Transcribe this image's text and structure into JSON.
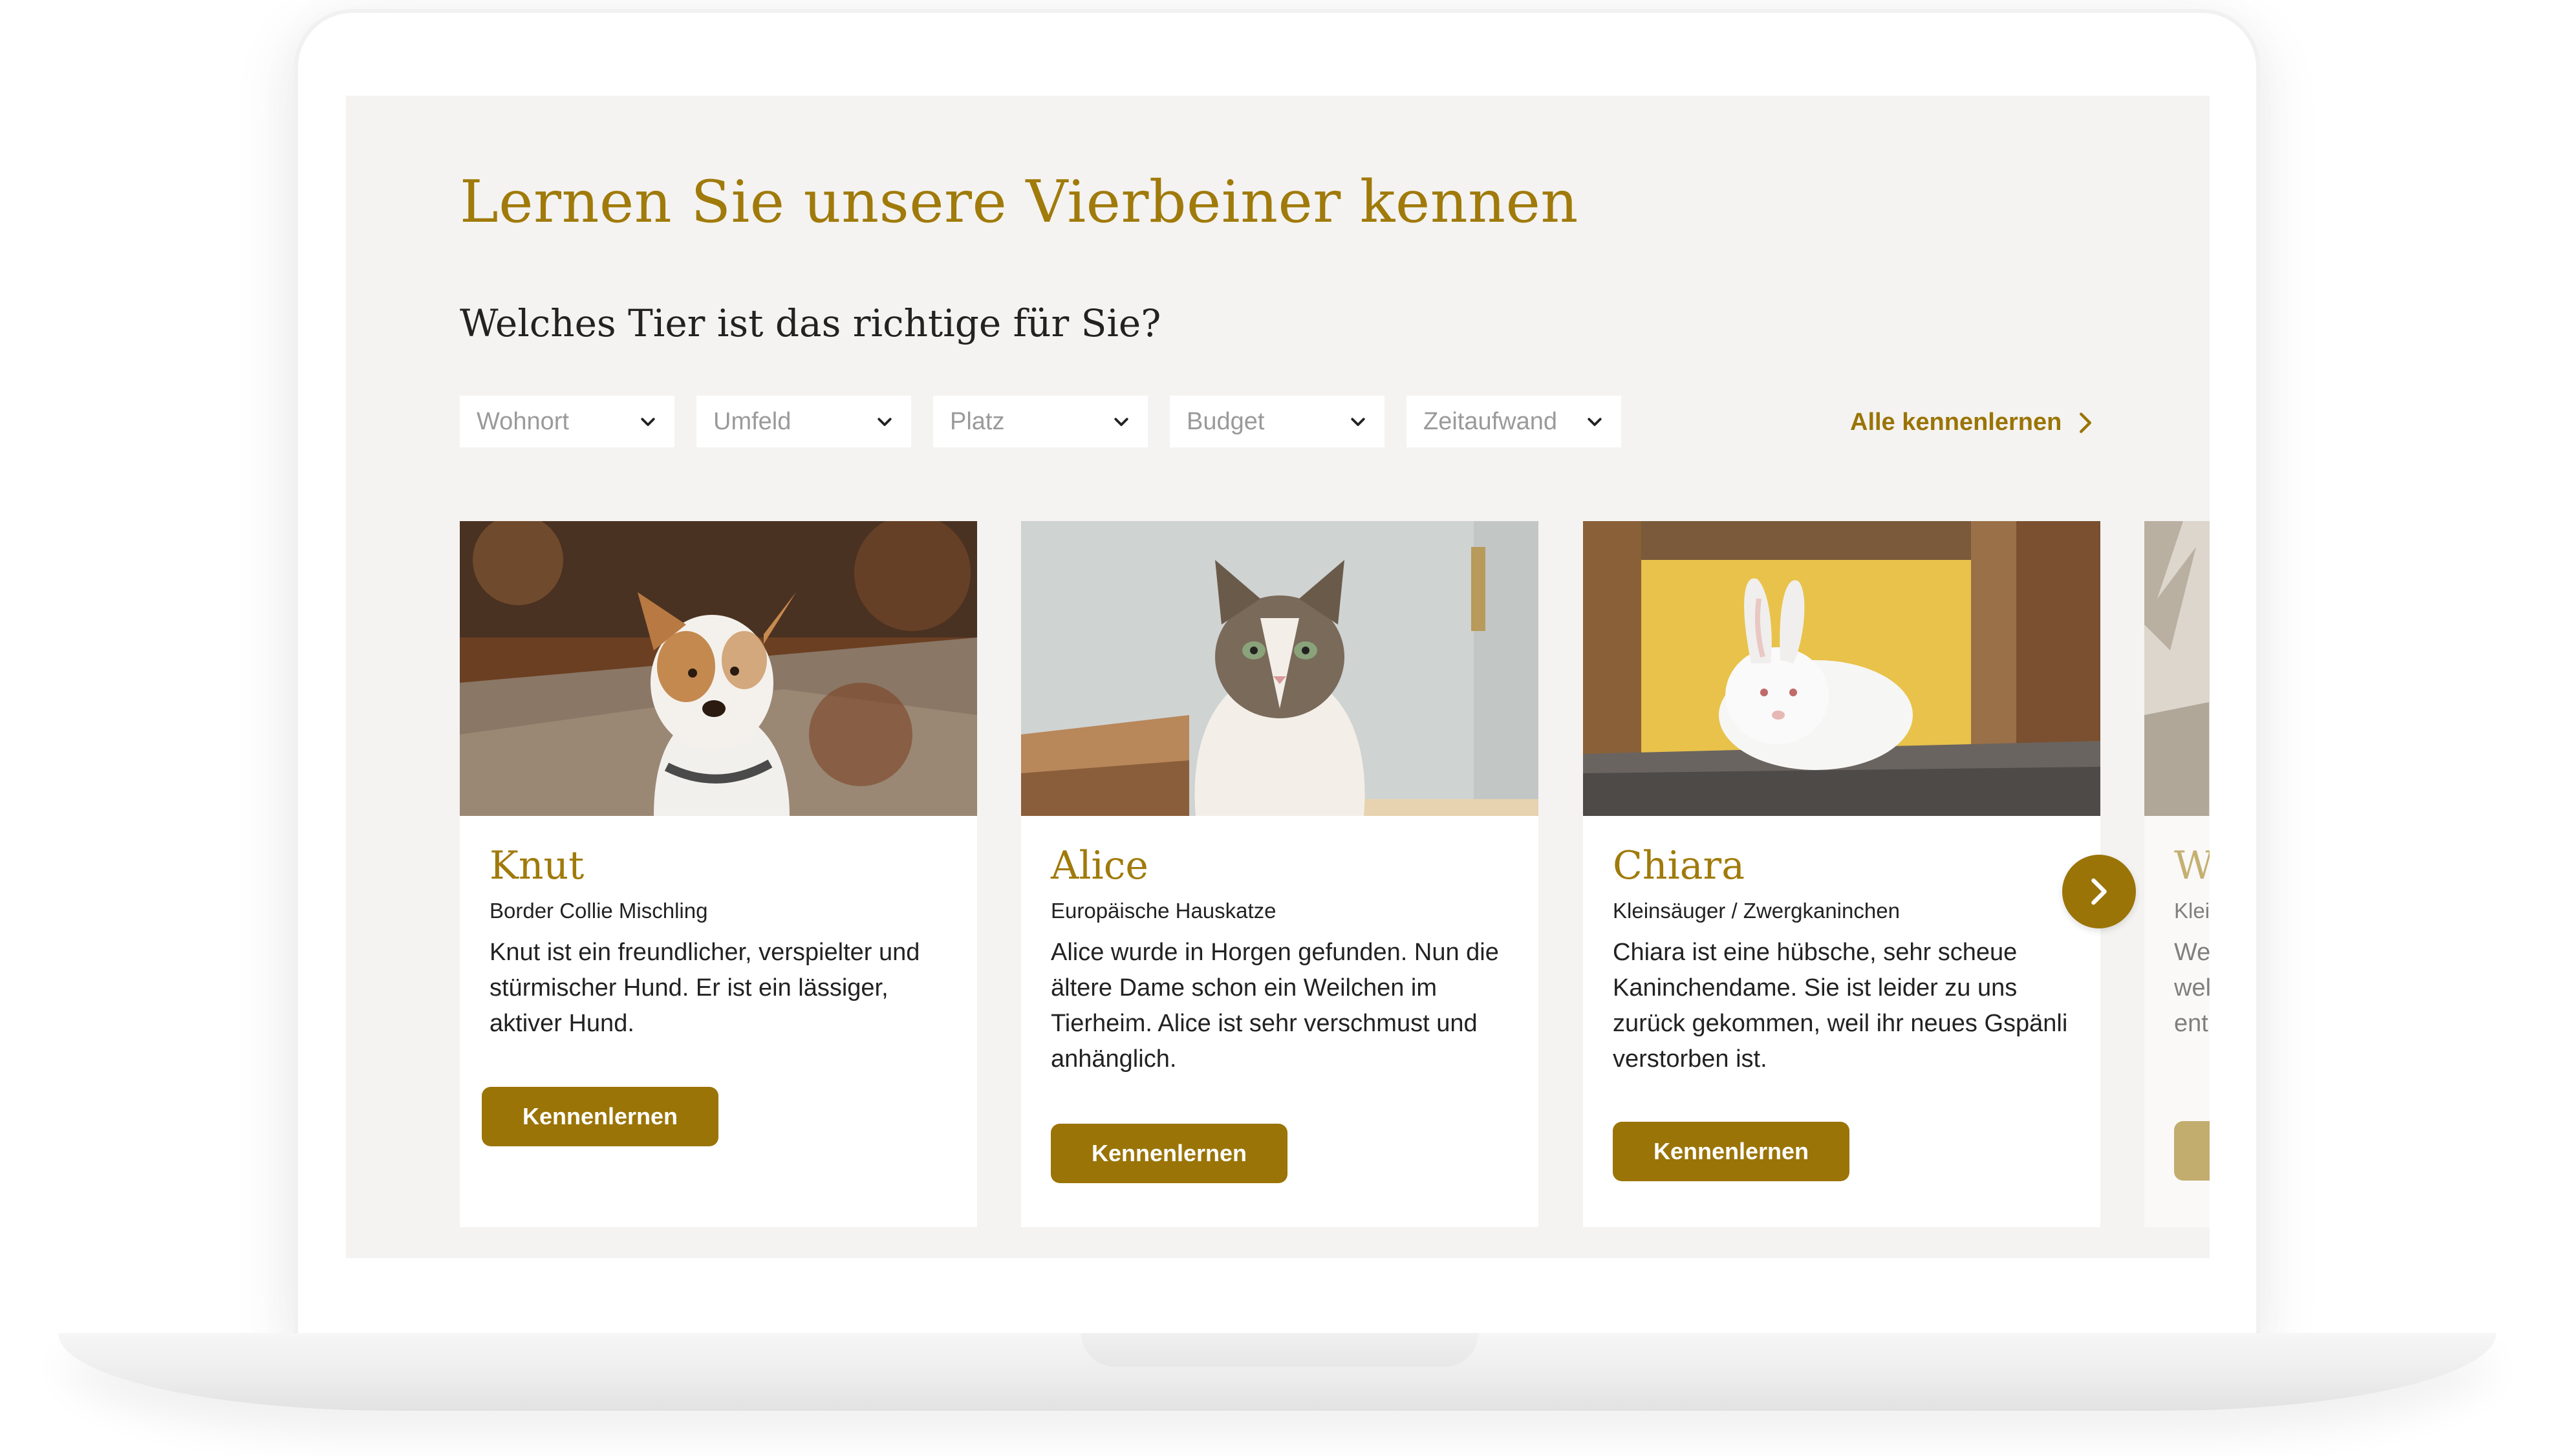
{
  "section": {
    "title": "Lernen Sie unsere Vierbeiner kennen",
    "subtitle": "Welches Tier ist das richtige für Sie?"
  },
  "filters": [
    {
      "placeholder": "Wohnort"
    },
    {
      "placeholder": "Umfeld"
    },
    {
      "placeholder": "Platz"
    },
    {
      "placeholder": "Budget"
    },
    {
      "placeholder": "Zeitaufwand"
    }
  ],
  "all_link": {
    "label": "Alle kennenlernen"
  },
  "cards": [
    {
      "name": "Knut",
      "breed": "Border Collie Mischling",
      "text": "Knut ist ein freundlicher, verspielter und stürmischer Hund. Er ist ein lässiger, aktiver Hund.",
      "button": "Kennenlernen"
    },
    {
      "name": "Alice",
      "breed": "Europäische Hauskatze",
      "text": "Alice wurde in Horgen gefunden. Nun die ältere Dame schon ein Weilchen im Tierheim. Alice ist sehr verschmust und anhänglich.",
      "button": "Kennenlernen"
    },
    {
      "name": "Chiara",
      "breed": "Kleinsäuger / Zwergkaninchen",
      "text": "Chiara ist eine hübsche, sehr scheue Kaninchendame. Sie ist leider zu uns zurück gekommen, weil ihr neues Gspänli verstorben ist.",
      "button": "Kennenlernen"
    },
    {
      "name": "W",
      "breed": "Klei",
      "text": "We wel ent",
      "button": ""
    }
  ],
  "colors": {
    "accent": "#9a7406",
    "heading": "#a07a0a",
    "screen_bg": "#f4f3f1"
  },
  "icons": {
    "filter_chevron": "chevron-down-icon",
    "link_chevron": "chevron-right-icon",
    "carousel_next": "arrow-right-icon"
  }
}
